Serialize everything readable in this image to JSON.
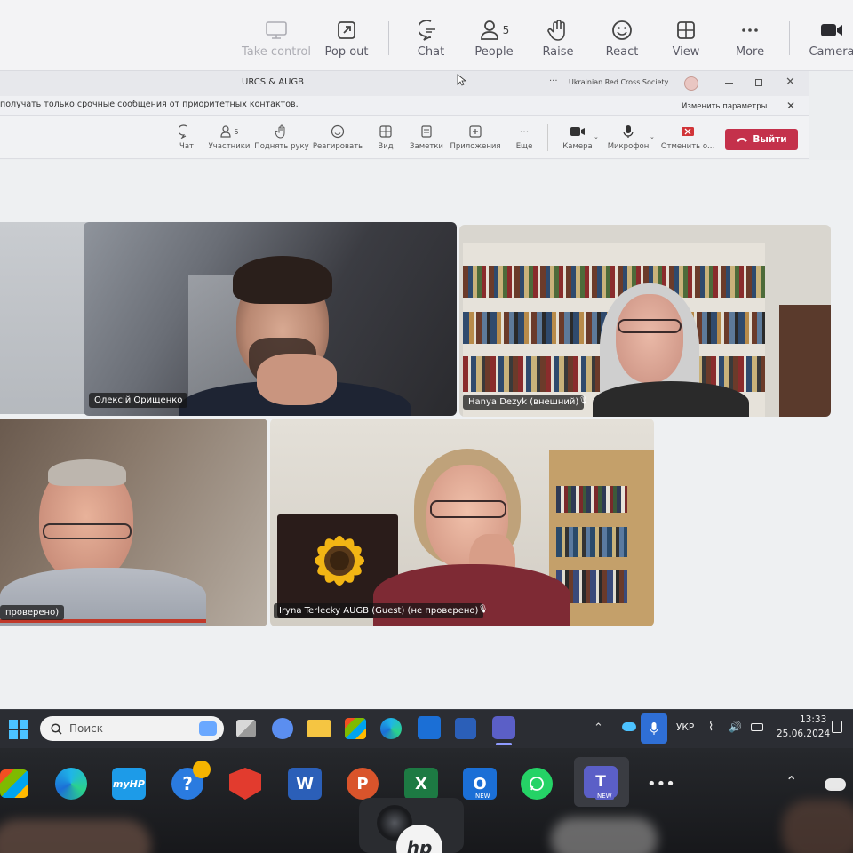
{
  "outer_toolbar": {
    "items": [
      {
        "label": "Take control",
        "icon": "take-control-icon"
      },
      {
        "label": "Pop out",
        "icon": "pop-out-icon"
      },
      {
        "label": "Chat",
        "icon": "chat-icon"
      },
      {
        "label": "People",
        "icon": "people-icon",
        "badge": "5"
      },
      {
        "label": "Raise",
        "icon": "raise-hand-icon"
      },
      {
        "label": "React",
        "icon": "react-icon"
      },
      {
        "label": "View",
        "icon": "view-icon"
      },
      {
        "label": "More",
        "icon": "more-icon"
      },
      {
        "label": "Camera",
        "icon": "camera-icon"
      }
    ]
  },
  "inner_window": {
    "title": "URCS & AUGB",
    "org": "Ukrainian Red Cross Society",
    "banner": "получать только срочные сообщения от приоритетных контактов.",
    "banner_action": "Изменить параметры",
    "toolbar": [
      {
        "label": "Чат",
        "icon": "chat-icon"
      },
      {
        "label": "Участники",
        "icon": "people-icon",
        "badge": "5"
      },
      {
        "label": "Поднять руку",
        "icon": "raise-hand-icon"
      },
      {
        "label": "Реагировать",
        "icon": "react-icon"
      },
      {
        "label": "Вид",
        "icon": "view-icon"
      },
      {
        "label": "Заметки",
        "icon": "notes-icon"
      },
      {
        "label": "Приложения",
        "icon": "apps-icon"
      },
      {
        "label": "Еще",
        "icon": "more-icon"
      },
      {
        "label": "Камера",
        "icon": "camera-icon"
      },
      {
        "label": "Микрофон",
        "icon": "mic-icon"
      },
      {
        "label": "Отменить о...",
        "icon": "share-stop-icon"
      }
    ],
    "leave_label": "Выйти"
  },
  "participants": [
    {
      "name": "Олексій Орищенко"
    },
    {
      "name": "Hanya Dezyk (внешний)"
    },
    {
      "name": "проверено)"
    },
    {
      "name": "Iryna Terlecky AUGB (Guest) (не проверено)"
    }
  ],
  "taskbar": {
    "search_placeholder": "Поиск",
    "lang": "УКР",
    "time": "13:33",
    "date": "25.06.2024"
  },
  "dock": {
    "new_badge": "NEW",
    "hp_label": "hp"
  },
  "colors": {
    "teams_purple": "#5b5fc7",
    "leave_red": "#c4314b",
    "screen_bg": "#eceef0"
  }
}
